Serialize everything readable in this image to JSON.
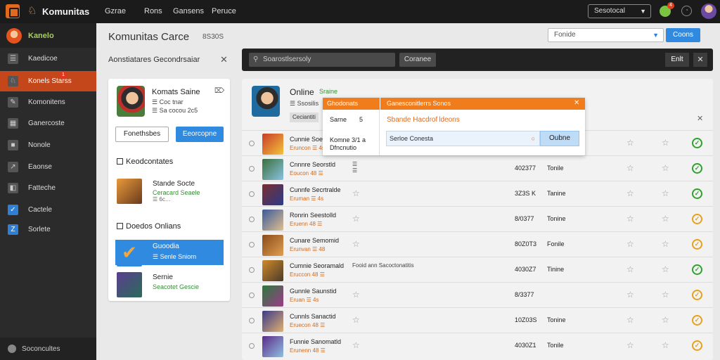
{
  "topbar": {
    "brand": "Komunitas",
    "nav": [
      "Gzrae",
      "Rons",
      "Gansens",
      "Peruce"
    ],
    "select_value": "Sesotocal",
    "notif_count": "4"
  },
  "sidebar": {
    "profile_name": "Kanelo",
    "items": [
      {
        "label": "Kaedicoe",
        "icon": "list-icon"
      },
      {
        "label": "Konels Starss",
        "icon": "game-icon",
        "badge": "1"
      },
      {
        "label": "Komonitens",
        "icon": "pen-icon"
      },
      {
        "label": "Ganercoste",
        "icon": "grid-icon"
      },
      {
        "label": "Nonole",
        "icon": "square-icon"
      },
      {
        "label": "Eaonse",
        "icon": "chart-icon"
      },
      {
        "label": "Fatteche",
        "icon": "panel-icon"
      },
      {
        "label": "Cactele",
        "icon": "check-icon"
      },
      {
        "label": "Sorlete",
        "icon": "z-icon"
      }
    ],
    "footer": "Soconcultes"
  },
  "header": {
    "title": "Komunitas Carce",
    "count": "8S30S",
    "search_value": "Fonide",
    "button": "Coons"
  },
  "filter": {
    "title": "Aonstiatares Gecondrsaiar",
    "profile_name": "Komats Saine",
    "profile_sub1": "☰ Coc tnar",
    "profile_sub2": "☰ Sa cocou 2c5",
    "btn_secondary": "Fonethsbes",
    "btn_primary": "Eeorcopne",
    "section1": "Keodcontates",
    "game1": {
      "title": "Stande Socte",
      "status": "Ceracard Seaele",
      "meta": "☰ 6c…"
    },
    "section2": "Doedos Onlians",
    "game2": {
      "title": "Guoodia",
      "status": "☰ Senle Sniorn"
    },
    "game3": {
      "title": "Sernie",
      "status": "Seacotet Gescie"
    }
  },
  "toolbar": {
    "search_placeholder": "Soarostlsersoly",
    "search_button": "Coranee",
    "edit": "Enlt"
  },
  "main": {
    "title": "Online",
    "status": "Sraine",
    "sub": "☰ Ssosilis",
    "tag": "Ceciantiti"
  },
  "rows": [
    {
      "name": "Cunnie Soenstte",
      "meta": "Eruncon ☰ 4s",
      "extra": "",
      "code": "",
      "status": "",
      "check": "ok"
    },
    {
      "name": "Cnnnre Seorstld",
      "meta": "Eoucon 48 ☰",
      "extra": "☰\n☰",
      "code": "402377",
      "status": "Tonile",
      "check": "ok"
    },
    {
      "name": "Cunnfe Secrtralde",
      "meta": "Eruman ☰ 4s",
      "extra": "",
      "code": "3Z3S K",
      "status": "Tanine",
      "check": "ok"
    },
    {
      "name": "Ronrin Seestolld",
      "meta": "Eruenn 48 ☰",
      "extra": "",
      "code": "8/0377",
      "status": "Tonine",
      "check": "warn"
    },
    {
      "name": "Cunare Semomid",
      "meta": "Erunvan ☰ 48",
      "extra": "",
      "code": "80Z0T3",
      "status": "Fonile",
      "check": "warn"
    },
    {
      "name": "Cumnie Seoramald",
      "meta": "Eruccon 48 ☰",
      "extra": "Fooid ann Sacoctonatitis",
      "code": "4030Z7",
      "status": "Tinine",
      "check": "ok"
    },
    {
      "name": "Gunnle Saunstid",
      "meta": "Eruan ☰ 4s",
      "extra": "",
      "code": "8/3377",
      "status": "",
      "check": "warn"
    },
    {
      "name": "Cunnls Sanactid",
      "meta": "Eruecon 48 ☰",
      "extra": "",
      "code": "10Z03S",
      "status": "Tonine",
      "check": "warn"
    },
    {
      "name": "Funnie Sanomatld",
      "meta": "Erunenn 48 ☰",
      "extra": "",
      "code": "4030Z1",
      "status": "Tonile",
      "check": "warn"
    }
  ],
  "popup": {
    "left_header": "Ghodonats",
    "row1_label": "Sarne",
    "row1_val": "5",
    "row2": "Komne 3/1 a\nDfncnutio",
    "right_header": "Ganesconitlerrs Sonos",
    "subtitle": "Sbande Hacdrof ldeons",
    "input_value": "Serloe Conesta",
    "ok": "Oubne"
  },
  "colors": {
    "accent_orange": "#f07c1c",
    "accent_blue": "#2f8ae0",
    "ok_green": "#2fa12f",
    "warn_amber": "#e6a11e"
  }
}
